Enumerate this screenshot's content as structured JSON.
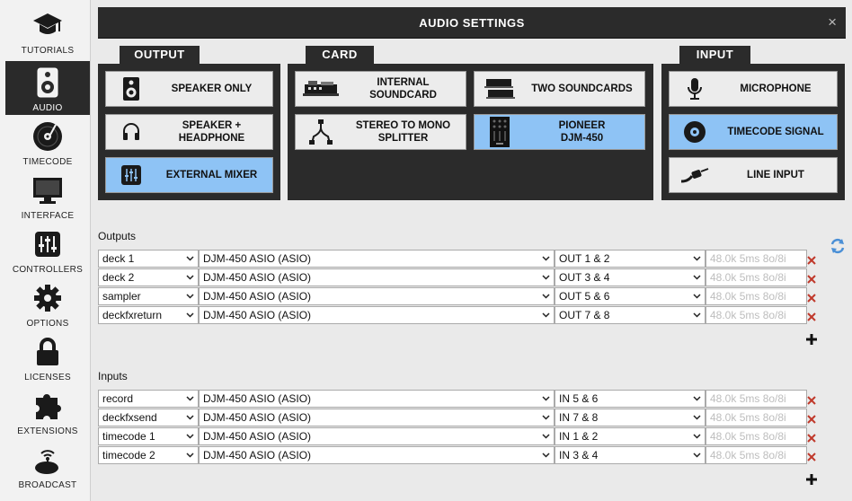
{
  "sidebar": {
    "items": [
      {
        "label": "TUTORIALS",
        "icon": "graduation-cap-icon",
        "active": false
      },
      {
        "label": "AUDIO",
        "icon": "speaker-icon",
        "active": true
      },
      {
        "label": "TIMECODE",
        "icon": "vinyl-icon",
        "active": false
      },
      {
        "label": "INTERFACE",
        "icon": "monitor-icon",
        "active": false
      },
      {
        "label": "CONTROLLERS",
        "icon": "mixer-faders-icon",
        "active": false
      },
      {
        "label": "OPTIONS",
        "icon": "gear-icon",
        "active": false
      },
      {
        "label": "LICENSES",
        "icon": "padlock-icon",
        "active": false
      },
      {
        "label": "EXTENSIONS",
        "icon": "puzzle-icon",
        "active": false
      },
      {
        "label": "BROADCAST",
        "icon": "broadcast-icon",
        "active": false
      }
    ]
  },
  "window": {
    "title": "AUDIO SETTINGS",
    "close": "×"
  },
  "output": {
    "tab": "OUTPUT",
    "options": [
      {
        "line1": "SPEAKER ONLY",
        "line2": "",
        "icon": "speaker-icon",
        "selected": false
      },
      {
        "line1": "SPEAKER +",
        "line2": "HEADPHONE",
        "icon": "headphone-icon",
        "selected": false
      },
      {
        "line1": "EXTERNAL MIXER",
        "line2": "",
        "icon": "mixer-icon",
        "selected": true
      }
    ]
  },
  "card": {
    "tab": "CARD",
    "options": [
      {
        "line1": "INTERNAL",
        "line2": "SOUNDCARD",
        "icon": "soundcard-icon",
        "selected": false
      },
      {
        "line1": "TWO SOUNDCARDS",
        "line2": "",
        "icon": "soundcards-icon",
        "selected": false
      },
      {
        "line1": "STEREO TO MONO",
        "line2": "SPLITTER",
        "icon": "splitter-cable-icon",
        "selected": false
      },
      {
        "line1": "PIONEER",
        "line2": "DJM-450",
        "icon": "djm-mixer-icon",
        "selected": true
      }
    ]
  },
  "input": {
    "tab": "INPUT",
    "options": [
      {
        "line1": "MICROPHONE",
        "line2": "",
        "icon": "microphone-icon",
        "selected": false
      },
      {
        "line1": "TIMECODE SIGNAL",
        "line2": "",
        "icon": "timecode-disc-icon",
        "selected": true
      },
      {
        "line1": "LINE INPUT",
        "line2": "",
        "icon": "line-cable-icon",
        "selected": false
      }
    ]
  },
  "outputs": {
    "label": "Outputs",
    "rows": [
      {
        "name": "deck 1",
        "device": "DJM-450 ASIO (ASIO)",
        "channel": "OUT 1 & 2",
        "info": "48.0k 5ms 8o/8i"
      },
      {
        "name": "deck 2",
        "device": "DJM-450 ASIO (ASIO)",
        "channel": "OUT 3 & 4",
        "info": "48.0k 5ms 8o/8i"
      },
      {
        "name": "sampler",
        "device": "DJM-450 ASIO (ASIO)",
        "channel": "OUT 5 & 6",
        "info": "48.0k 5ms 8o/8i"
      },
      {
        "name": "deckfxreturn",
        "device": "DJM-450 ASIO (ASIO)",
        "channel": "OUT 7 & 8",
        "info": "48.0k 5ms 8o/8i"
      }
    ]
  },
  "inputs": {
    "label": "Inputs",
    "rows": [
      {
        "name": "record",
        "device": "DJM-450 ASIO (ASIO)",
        "channel": "IN 5 & 6",
        "info": "48.0k 5ms 8o/8i"
      },
      {
        "name": "deckfxsend",
        "device": "DJM-450 ASIO (ASIO)",
        "channel": "IN 7 & 8",
        "info": "48.0k 5ms 8o/8i"
      },
      {
        "name": "timecode 1",
        "device": "DJM-450 ASIO (ASIO)",
        "channel": "IN 1 & 2",
        "info": "48.0k 5ms 8o/8i"
      },
      {
        "name": "timecode 2",
        "device": "DJM-450 ASIO (ASIO)",
        "channel": "IN 3 & 4",
        "info": "48.0k 5ms 8o/8i"
      }
    ]
  },
  "colors": {
    "selected": "#8ec3f5",
    "panel": "#2b2b2b",
    "delete": "#c0392b"
  }
}
